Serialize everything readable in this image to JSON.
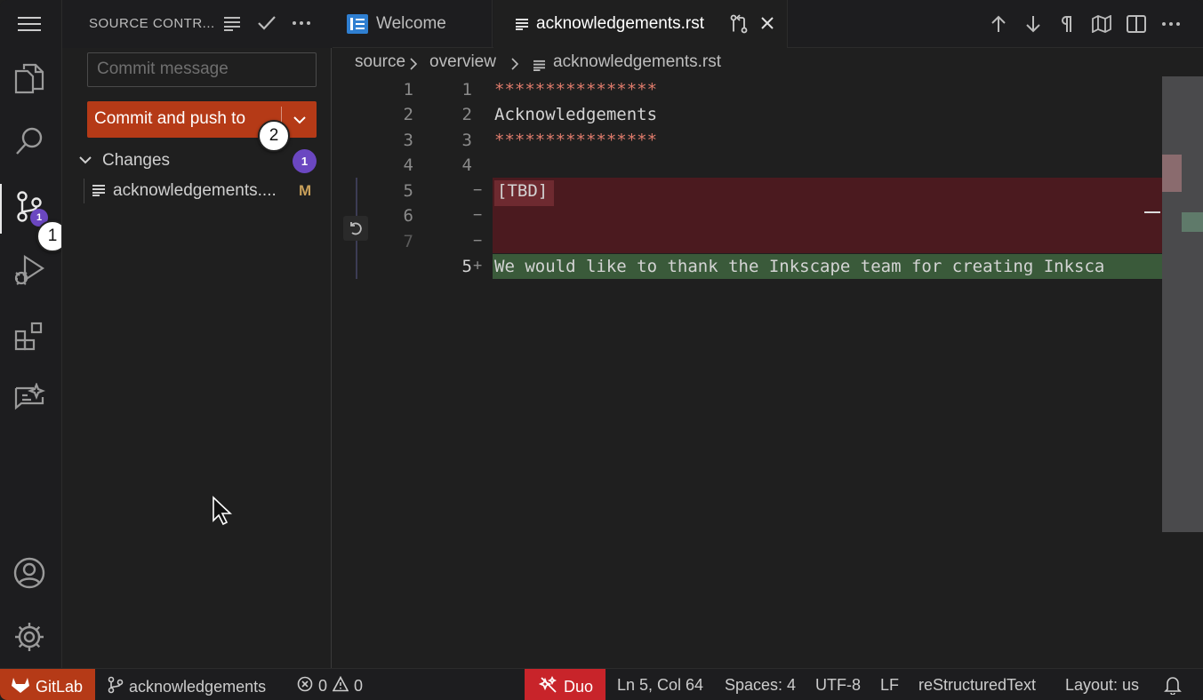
{
  "activity_bar": {
    "scm_badge": "1",
    "callout_1": "1"
  },
  "sidebar": {
    "title": "SOURCE CONTR...",
    "commit_placeholder": "Commit message",
    "commit_button_label": "Commit and push to",
    "callout_2": "2",
    "changes_label": "Changes",
    "changes_count": "1",
    "files": [
      {
        "name": "acknowledgements....",
        "status": "M"
      }
    ]
  },
  "tabs": [
    {
      "label": "Welcome"
    },
    {
      "label": "acknowledgements.rst"
    }
  ],
  "breadcrumb": {
    "part1": "source",
    "part2": "overview",
    "part3": "acknowledgements.rst"
  },
  "editor": {
    "left_line_numbers": [
      "1",
      "2",
      "3",
      "4",
      "5",
      "6",
      "7"
    ],
    "right_line_numbers": [
      "1",
      "2",
      "3",
      "4",
      "5"
    ],
    "lines": [
      "****************",
      "Acknowledgements",
      "****************",
      "",
      "[TBD]",
      "",
      "",
      "We would like to thank the Inkscape team for creating Inksca"
    ],
    "markers": {
      "del": "−",
      "add": "+"
    }
  },
  "status_bar": {
    "gitlab": "GitLab",
    "branch": "acknowledgements",
    "errors": "0",
    "warnings": "0",
    "duo": "Duo",
    "position": "Ln 5, Col 64",
    "spaces": "Spaces: 4",
    "encoding": "UTF-8",
    "eol": "LF",
    "language": "reStructuredText",
    "layout": "Layout: us"
  },
  "colors": {
    "accent_commit": "#b53a17",
    "badge": "#6b47c1",
    "deleted_line": "#4b1a1f",
    "added_line": "#3a5a3a"
  }
}
